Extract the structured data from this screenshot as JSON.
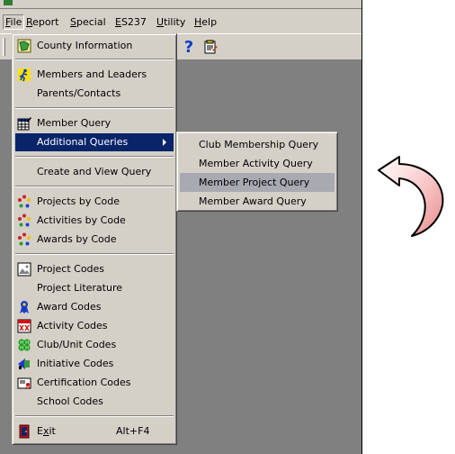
{
  "menubar": {
    "items": [
      {
        "label_u": "F",
        "label_rest": "ile"
      },
      {
        "label_u": "R",
        "label_rest": "eport",
        "label": "Report"
      },
      {
        "label_u": "S",
        "label_rest": "pecial"
      },
      {
        "label_u": "E",
        "label_rest": "S237"
      },
      {
        "label_u": "U",
        "label_rest": "tility"
      },
      {
        "label_u": "H",
        "label_rest": "elp"
      }
    ]
  },
  "toolbar": {
    "help_glyph": "?",
    "icons": [
      "help-icon",
      "notepad-icon"
    ]
  },
  "file_menu": {
    "items": {
      "county_information": "County Information",
      "members_and_leaders": "Members and Leaders",
      "parents_contacts": "Parents/Contacts",
      "member_query": "Member Query",
      "additional_queries": "Additional Queries",
      "create_and_view_query": "Create and View Query",
      "projects_by_code": "Projects by Code",
      "activities_by_code": "Activities by Code",
      "awards_by_code": "Awards by Code",
      "project_codes": "Project Codes",
      "project_literature": "Project Literature",
      "award_codes": "Award Codes",
      "activity_codes": "Activity Codes",
      "club_unit_codes": "Club/Unit Codes",
      "initiative_codes": "Initiative Codes",
      "certification_codes": "Certification Codes",
      "school_codes": "School Codes",
      "exit_u": "x",
      "exit_pre": "E",
      "exit_post": "it",
      "exit_shortcut": "Alt+F4"
    }
  },
  "submenu": {
    "items": [
      "Club Membership Query",
      "Member Activity Query",
      "Member Project Query",
      "Member Award Query"
    ],
    "highlighted": "Member Project Query"
  },
  "colors": {
    "chrome": "#d4d0c8",
    "selection": "#0a246a",
    "submenu_hover": "#a9a9b1",
    "arrow_fill": "#f4b3b3"
  }
}
